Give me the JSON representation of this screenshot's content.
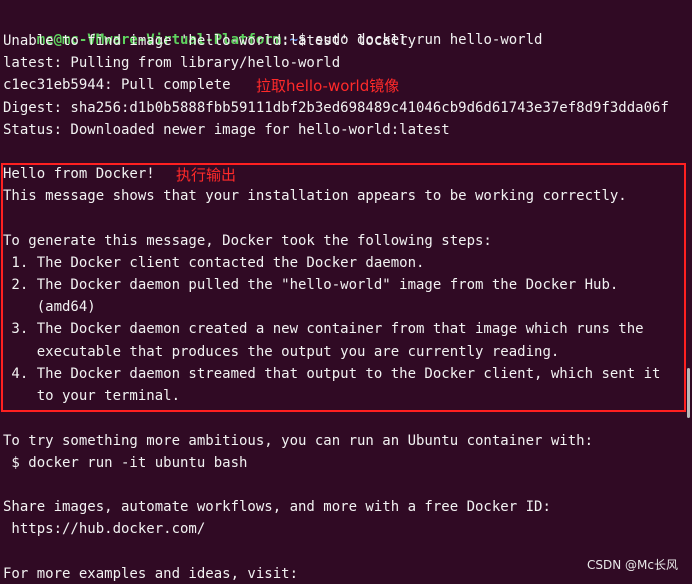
{
  "terminal": {
    "prompt": {
      "user_host": "mc@mc-VMware-Virtual-Platform",
      "separator": ":",
      "path": "~",
      "symbol": "$",
      "command": " sudo docker run hello-world"
    },
    "lines": [
      "Unable to find image 'hello-world:latest' locally",
      "latest: Pulling from library/hello-world",
      "c1ec31eb5944: Pull complete",
      "Digest: sha256:d1b0b5888fbb59111dbf2b3ed698489c41046cb9d6d61743e37ef8d9f3dda06f",
      "Status: Downloaded newer image for hello-world:latest",
      "",
      "Hello from Docker!",
      "This message shows that your installation appears to be working correctly.",
      "",
      "To generate this message, Docker took the following steps:",
      " 1. The Docker client contacted the Docker daemon.",
      " 2. The Docker daemon pulled the \"hello-world\" image from the Docker Hub.",
      "    (amd64)",
      " 3. The Docker daemon created a new container from that image which runs the",
      "    executable that produces the output you are currently reading.",
      " 4. The Docker daemon streamed that output to the Docker client, which sent it",
      "    to your terminal.",
      "",
      "To try something more ambitious, you can run an Ubuntu container with:",
      " $ docker run -it ubuntu bash",
      "",
      "Share images, automate workflows, and more with a free Docker ID:",
      " https://hub.docker.com/",
      "",
      "For more examples and ideas, visit:"
    ]
  },
  "annotations": {
    "pull_image": "拉取hello-world镜像",
    "run_output": "执行输出"
  },
  "watermark": "CSDN @Mc长风",
  "colors": {
    "background": "#300a24",
    "text": "#f2f2f2",
    "prompt_user": "#5fd35f",
    "prompt_path": "#6fa1ff",
    "annotation": "#ff2a2a",
    "highlight_border": "#ff2020"
  }
}
